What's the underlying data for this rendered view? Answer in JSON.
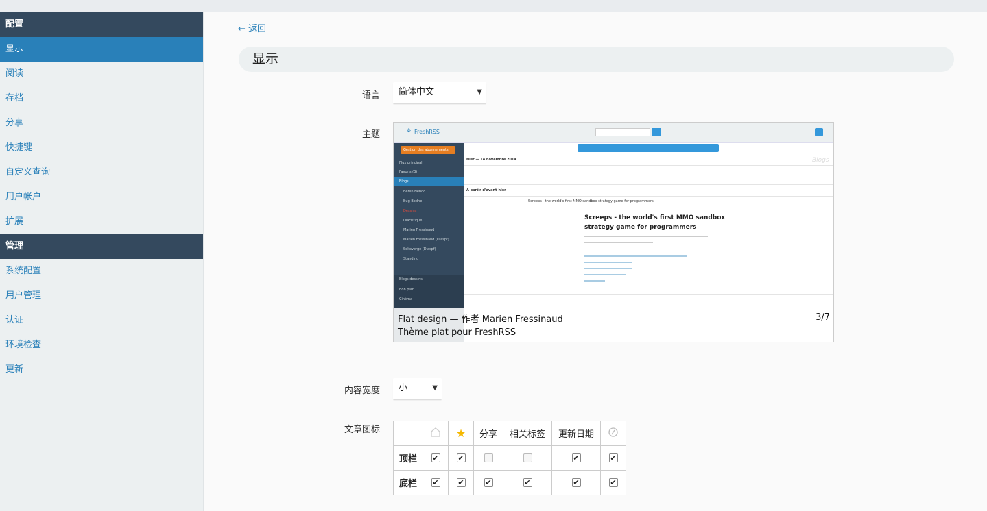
{
  "sidebar": {
    "sections": [
      {
        "title": "配置",
        "items": [
          {
            "label": "显示",
            "active": true
          },
          {
            "label": "阅读",
            "active": false
          },
          {
            "label": "存档",
            "active": false
          },
          {
            "label": "分享",
            "active": false
          },
          {
            "label": "快捷键",
            "active": false
          },
          {
            "label": "自定义查询",
            "active": false
          },
          {
            "label": "用户帐户",
            "active": false
          },
          {
            "label": "扩展",
            "active": false
          }
        ]
      },
      {
        "title": "管理",
        "items": [
          {
            "label": "系统配置",
            "active": false
          },
          {
            "label": "用户管理",
            "active": false
          },
          {
            "label": "认证",
            "active": false
          },
          {
            "label": "环境检查",
            "active": false
          },
          {
            "label": "更新",
            "active": false
          }
        ]
      }
    ]
  },
  "main": {
    "back_label": "← 返回",
    "page_title": "显示",
    "language": {
      "label": "语言",
      "value": "简体中文"
    },
    "theme": {
      "label": "主题",
      "caption_line1": "Flat design — 作者 Marien Fressinaud",
      "caption_line2": "Thème plat pour FreshRSS",
      "counter": "3/7",
      "preview": {
        "brand": "FreshRSS",
        "subscribe_button": "Gestion des abonnements",
        "nav": [
          "Flux principal",
          "Favoris (3)",
          "Blogs",
          "Berlin Hebdo",
          "Bug Bodhe",
          "Dessins",
          "Diacritique",
          "Marien Fressinaud",
          "Marien Fressinaud (Diaspf)",
          "Sokoverge (Diaspf)",
          "Standing",
          "Blogs dessins",
          "Bon plan",
          "Cinéma"
        ],
        "date_heading_1": "Hier — 14 novembre 2014",
        "date_heading_2": "À partir d'avant-hier",
        "article_title": "Screeps - the world's first MMO sandbox strategy game for programmers",
        "article_heading_1": "Screeps - the world's first MMO sandbox",
        "article_heading_2": "strategy game for programmers",
        "category_tag": "Blogs"
      }
    },
    "content_width": {
      "label": "内容宽度",
      "value": "小"
    },
    "article_icons": {
      "label": "文章图标",
      "columns": [
        {
          "type": "icon",
          "icon": "read-icon"
        },
        {
          "type": "icon",
          "icon": "star-icon"
        },
        {
          "type": "text",
          "text": "分享"
        },
        {
          "type": "text",
          "text": "相关标签"
        },
        {
          "type": "text",
          "text": "更新日期"
        },
        {
          "type": "icon",
          "icon": "link-icon"
        }
      ],
      "rows": [
        {
          "label": "顶栏",
          "checked": [
            true,
            true,
            false,
            false,
            true,
            true
          ]
        },
        {
          "label": "底栏",
          "checked": [
            true,
            true,
            true,
            true,
            true,
            true
          ]
        }
      ]
    }
  },
  "colors": {
    "sidebar_header": "#34495e",
    "accent": "#2980b9",
    "star": "#f5b800"
  }
}
